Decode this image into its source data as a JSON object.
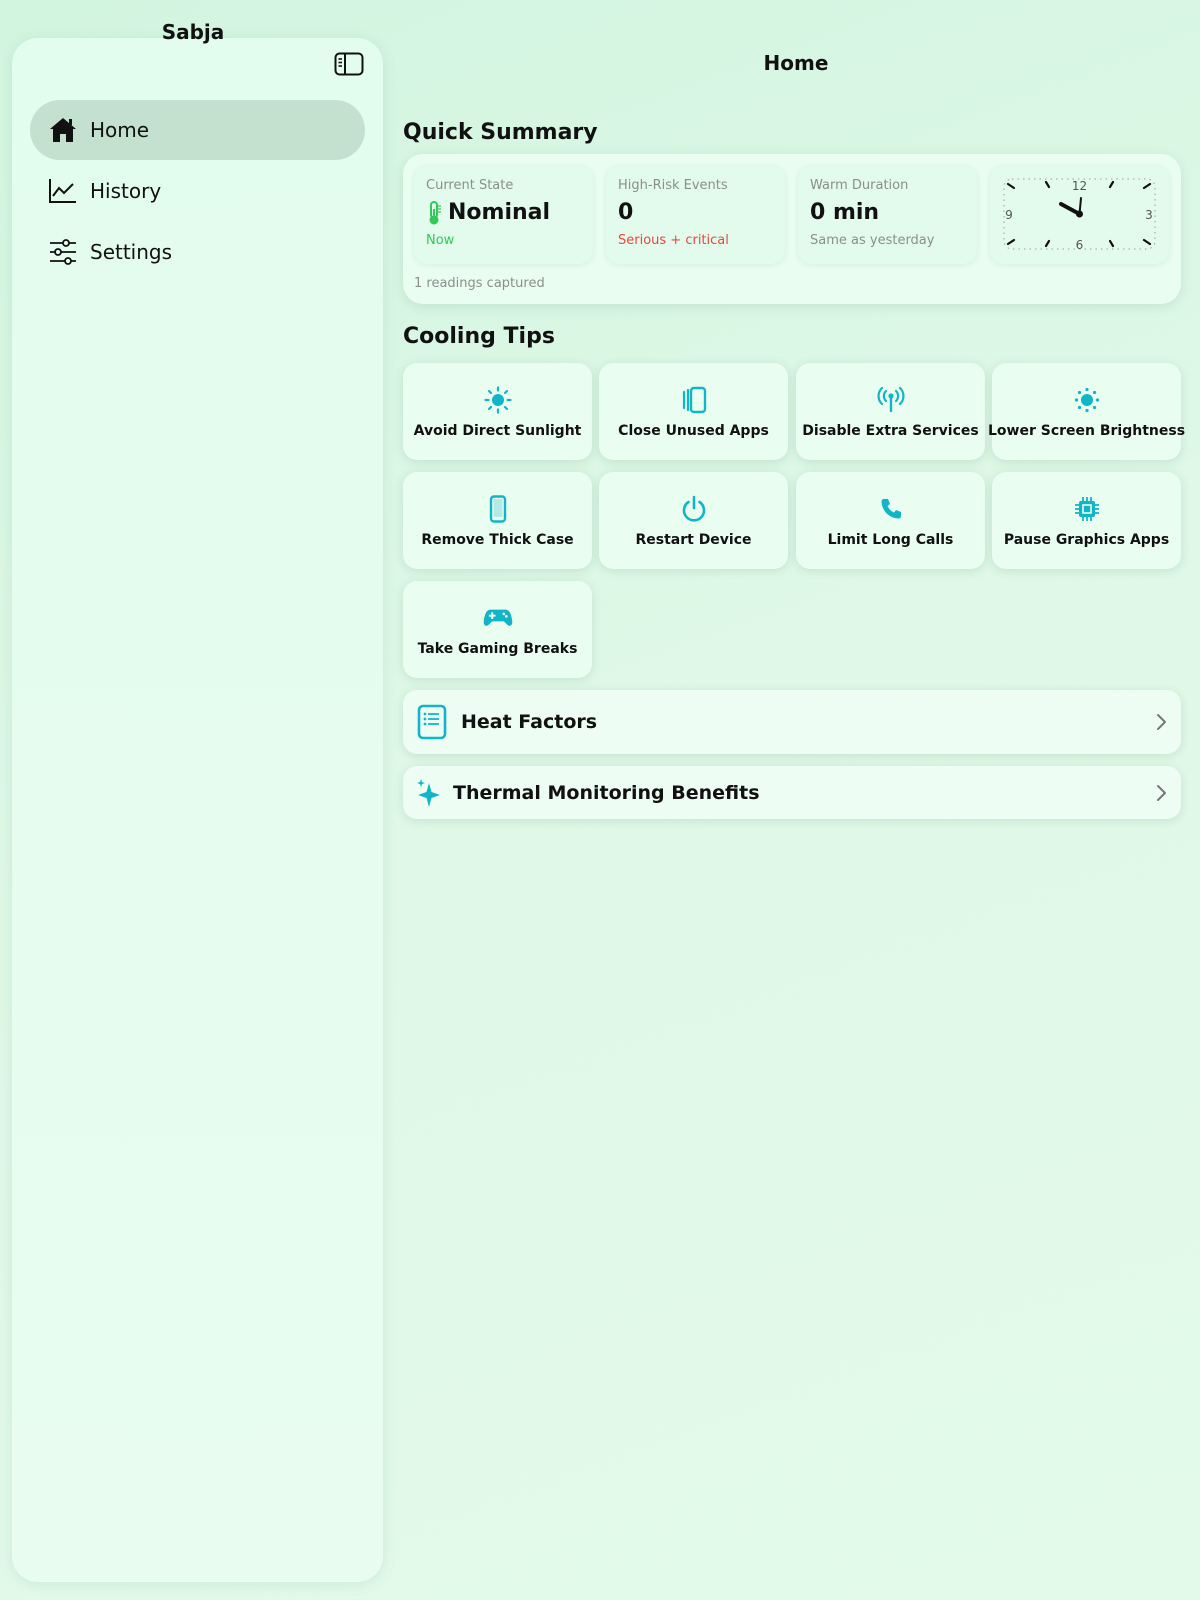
{
  "sidebar": {
    "title": "Sabja",
    "items": [
      {
        "label": "Home",
        "icon": "house-icon",
        "active": true
      },
      {
        "label": "History",
        "icon": "chart-line-icon",
        "active": false
      },
      {
        "label": "Settings",
        "icon": "sliders-icon",
        "active": false
      }
    ]
  },
  "page": {
    "title": "Home"
  },
  "summary": {
    "title": "Quick Summary",
    "stats": [
      {
        "label": "Current State",
        "value": "Nominal",
        "sub": "Now",
        "icon": "thermometer-icon"
      },
      {
        "label": "High-Risk Events",
        "value": "0",
        "sub": "Serious + critical"
      },
      {
        "label": "Warm Duration",
        "value": "0 min",
        "sub": "Same as yesterday"
      }
    ],
    "clock": {
      "n12": "12",
      "n3": "3",
      "n6": "6",
      "n9": "9"
    },
    "note": "1 readings captured"
  },
  "tips": {
    "title": "Cooling Tips",
    "items": [
      {
        "label": "Avoid Direct Sunlight",
        "icon": "sun-icon"
      },
      {
        "label": "Close Unused Apps",
        "icon": "app-stack-icon"
      },
      {
        "label": "Disable Extra Services",
        "icon": "antenna-icon"
      },
      {
        "label": "Lower Screen Brightness",
        "icon": "brightness-icon"
      },
      {
        "label": "Remove Thick Case",
        "icon": "phone-icon"
      },
      {
        "label": "Restart Device",
        "icon": "power-icon"
      },
      {
        "label": "Limit Long Calls",
        "icon": "phone-call-icon"
      },
      {
        "label": "Pause Graphics Apps",
        "icon": "chip-icon"
      },
      {
        "label": "Take Gaming Breaks",
        "icon": "gamepad-icon"
      }
    ]
  },
  "rows": {
    "heat_factors": "Heat Factors",
    "benefits": "Thermal Monitoring Benefits"
  },
  "colors": {
    "accent": "#12b5c8",
    "green": "#34c759",
    "red": "#e5483f"
  }
}
